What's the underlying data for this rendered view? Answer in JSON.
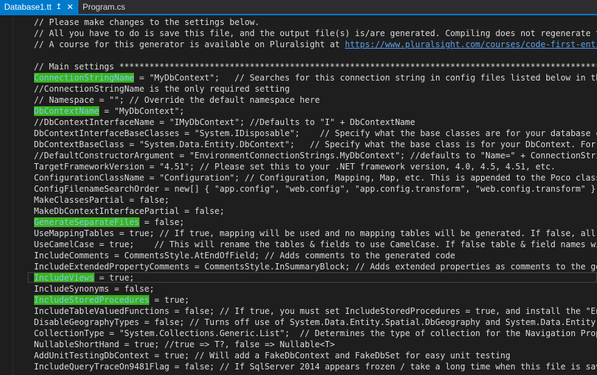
{
  "tabs": [
    {
      "label": "Database1.tt",
      "active": true,
      "pin_icon": "pin-icon",
      "close_icon": "close-icon"
    },
    {
      "label": "Program.cs",
      "active": false
    }
  ],
  "colors": {
    "background": "#1e1e1e",
    "tab_active": "#007acc",
    "highlight": "#3cb21c",
    "text": "#dcdcdc",
    "link": "#5aa2f0"
  },
  "lines": [
    {
      "indent": "    ",
      "pre": "// Please make changes to the settings below."
    },
    {
      "indent": "    ",
      "pre": "// All you have to do is save this file, and the output file(s) is/are generated. Compiling does not regenerate the file(s)."
    },
    {
      "indent": "    ",
      "pre": "// A course for this generator is available on Pluralsight at ",
      "link": "https://www.pluralsight.com/courses/code-first-entity-framework-legacy-databases"
    },
    {
      "indent": "",
      "pre": ""
    },
    {
      "indent": "    ",
      "pre": "// Main settings **********************************************************************************************************************"
    },
    {
      "indent": "    ",
      "highlight": "ConnectionStringName",
      "post": " = \"MyDbContext\";   // Searches for this connection string in config files listed below in the ConfigFilenameSearchOrder setting"
    },
    {
      "indent": "    ",
      "pre": "//ConnectionStringName is the only required setting"
    },
    {
      "indent": "    ",
      "pre": "// Namespace = \"\"; // Override the default namespace here"
    },
    {
      "indent": "    ",
      "highlight": "DbContextName",
      "post": " = \"MyDbContext\";"
    },
    {
      "indent": "    ",
      "pre": "//DbContextInterfaceName = \"IMyDbContext\"; //Defaults to \"I\" + DbContextName"
    },
    {
      "indent": "    ",
      "pre": "DbContextInterfaceBaseClasses = \"System.IDisposable\";    // Specify what the base classes are for your database context interface"
    },
    {
      "indent": "    ",
      "pre": "DbContextBaseClass = \"System.Data.Entity.DbContext\";   // Specify what the base class is for your DbContext. For ASP.NET Identity use"
    },
    {
      "indent": "    ",
      "pre": "//DefaultConstructorArgument = \"EnvironmentConnectionStrings.MyDbContext\"; //defaults to \"Name=\" + ConnectionStringName, use null"
    },
    {
      "indent": "    ",
      "pre": "TargetFrameworkVersion = \"4.51\"; // Please set this to your .NET framework version, 4.0, 4.5, 4.51, etc."
    },
    {
      "indent": "    ",
      "pre": "ConfigurationClassName = \"Configuration\"; // Configuration, Mapping, Map, etc. This is appended to the Poco class name"
    },
    {
      "indent": "    ",
      "pre": "ConfigFilenameSearchOrder = new[] { \"app.config\", \"web.config\", \"app.config.transform\", \"web.config.transform\" }; // Add more here"
    },
    {
      "indent": "    ",
      "pre": "MakeClassesPartial = false;"
    },
    {
      "indent": "    ",
      "pre": "MakeDbContextInterfacePartial = false;"
    },
    {
      "indent": "    ",
      "highlight": "GenerateSeparateFiles",
      "post": " = false;"
    },
    {
      "indent": "    ",
      "pre": "UseMappingTables = true; // If true, mapping will be used and no mapping tables will be generated. If false, all tables will be generated."
    },
    {
      "indent": "    ",
      "pre": "UseCamelCase = true;    // This will rename the tables & fields to use CamelCase. If false table & field names will be left alone."
    },
    {
      "indent": "    ",
      "pre": "IncludeComments = CommentsStyle.AtEndOfField; // Adds comments to the generated code"
    },
    {
      "indent": "    ",
      "pre": "IncludeExtendedPropertyComments = CommentsStyle.InSummaryBlock; // Adds extended properties as comments to the generated code"
    },
    {
      "indent": "    ",
      "highlight": "IncludeViews",
      "post": " = true;",
      "current": true
    },
    {
      "indent": "    ",
      "pre": "IncludeSynonyms = false;"
    },
    {
      "indent": "    ",
      "highlight": "IncludeStoredProcedures",
      "post": " = true;"
    },
    {
      "indent": "    ",
      "pre": "IncludeTableValuedFunctions = false; // If true, you must set IncludeStoredProcedures = true, and install the \"EntityFramework.CodeFirstStoreFunctions\""
    },
    {
      "indent": "    ",
      "pre": "DisableGeographyTypes = false; // Turns off use of System.Data.Entity.Spatial.DbGeography and System.Data.Entity.Spatial.DbGeometry"
    },
    {
      "indent": "    ",
      "pre": "CollectionType = \"System.Collections.Generic.List\";  // Determines the type of collection for the Navigation Properties."
    },
    {
      "indent": "    ",
      "pre": "NullableShortHand = true; //true => T?, false => Nullable<T>"
    },
    {
      "indent": "    ",
      "pre": "AddUnitTestingDbContext = true; // Will add a FakeDbContext and FakeDbSet for easy unit testing"
    },
    {
      "indent": "    ",
      "pre": "IncludeQueryTraceOn9481Flag = false; // If SqlServer 2014 appears frozen / take a long time when this file is saved, try setting this to true"
    }
  ]
}
